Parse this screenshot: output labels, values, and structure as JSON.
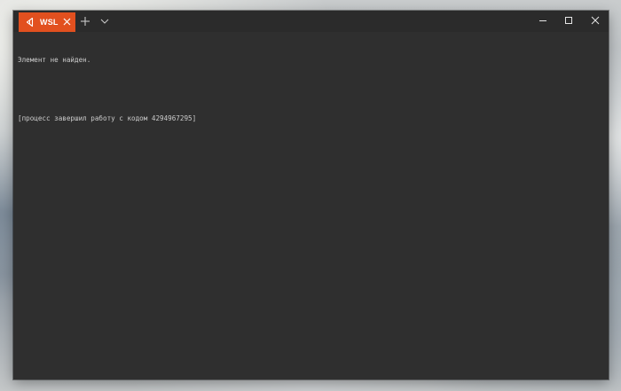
{
  "tabs": [
    {
      "label": "WSL",
      "icon": "terminal-arrow-icon",
      "active": true,
      "color": "#e2501f"
    }
  ],
  "titlebar": {
    "new_tab_icon": "plus-icon",
    "dropdown_icon": "chevron-down-icon",
    "window_controls": [
      "minimize-icon",
      "maximize-icon",
      "close-icon"
    ]
  },
  "terminal": {
    "lines": [
      "Элемент не найден.",
      "",
      "[процесс завершил работу с кодом 4294967295]"
    ],
    "background": "#2f2f2f",
    "foreground": "#cccccc"
  }
}
